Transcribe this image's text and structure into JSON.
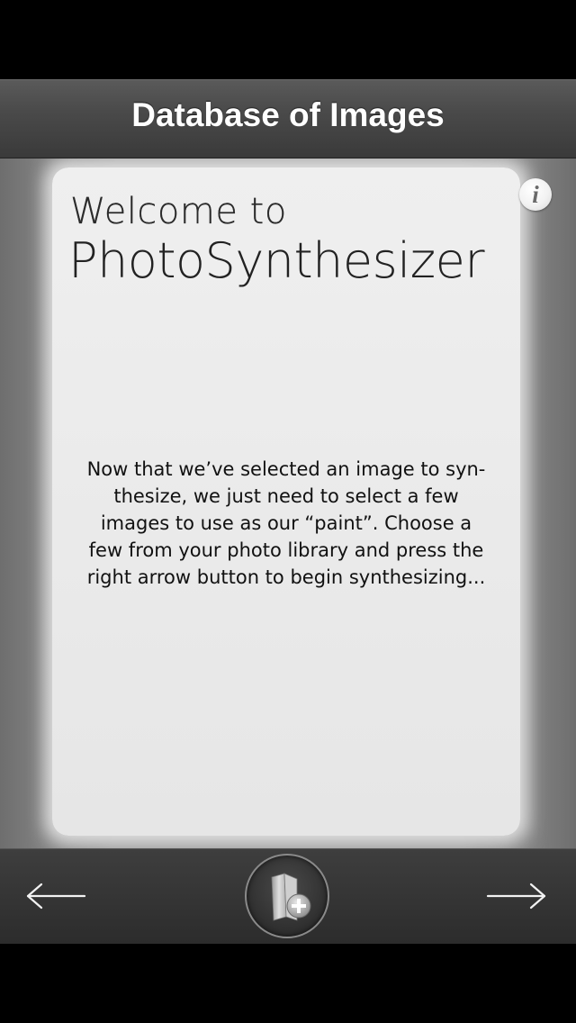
{
  "nav": {
    "title": "Database of Images"
  },
  "welcome": {
    "line1": "Welcome to",
    "line2": "PhotoSynthesizer"
  },
  "info": {
    "glyph": "i",
    "icon": "info-icon"
  },
  "body": {
    "text": "Now that we’ve selected an image to syn-\nthesize, we just need to select a few\nimages to use as our “paint”.  Choose a\nfew from your photo library and press the\nright arrow button to begin synthesizing..."
  },
  "toolbar": {
    "back_icon": "left-arrow-icon",
    "add_icon": "add-photo-folder-icon",
    "forward_icon": "right-arrow-icon"
  },
  "colors": {
    "nav_bar": "#4a4a4a",
    "card": "#eaeaea",
    "toolbar": "#333333",
    "text": "#111111"
  }
}
